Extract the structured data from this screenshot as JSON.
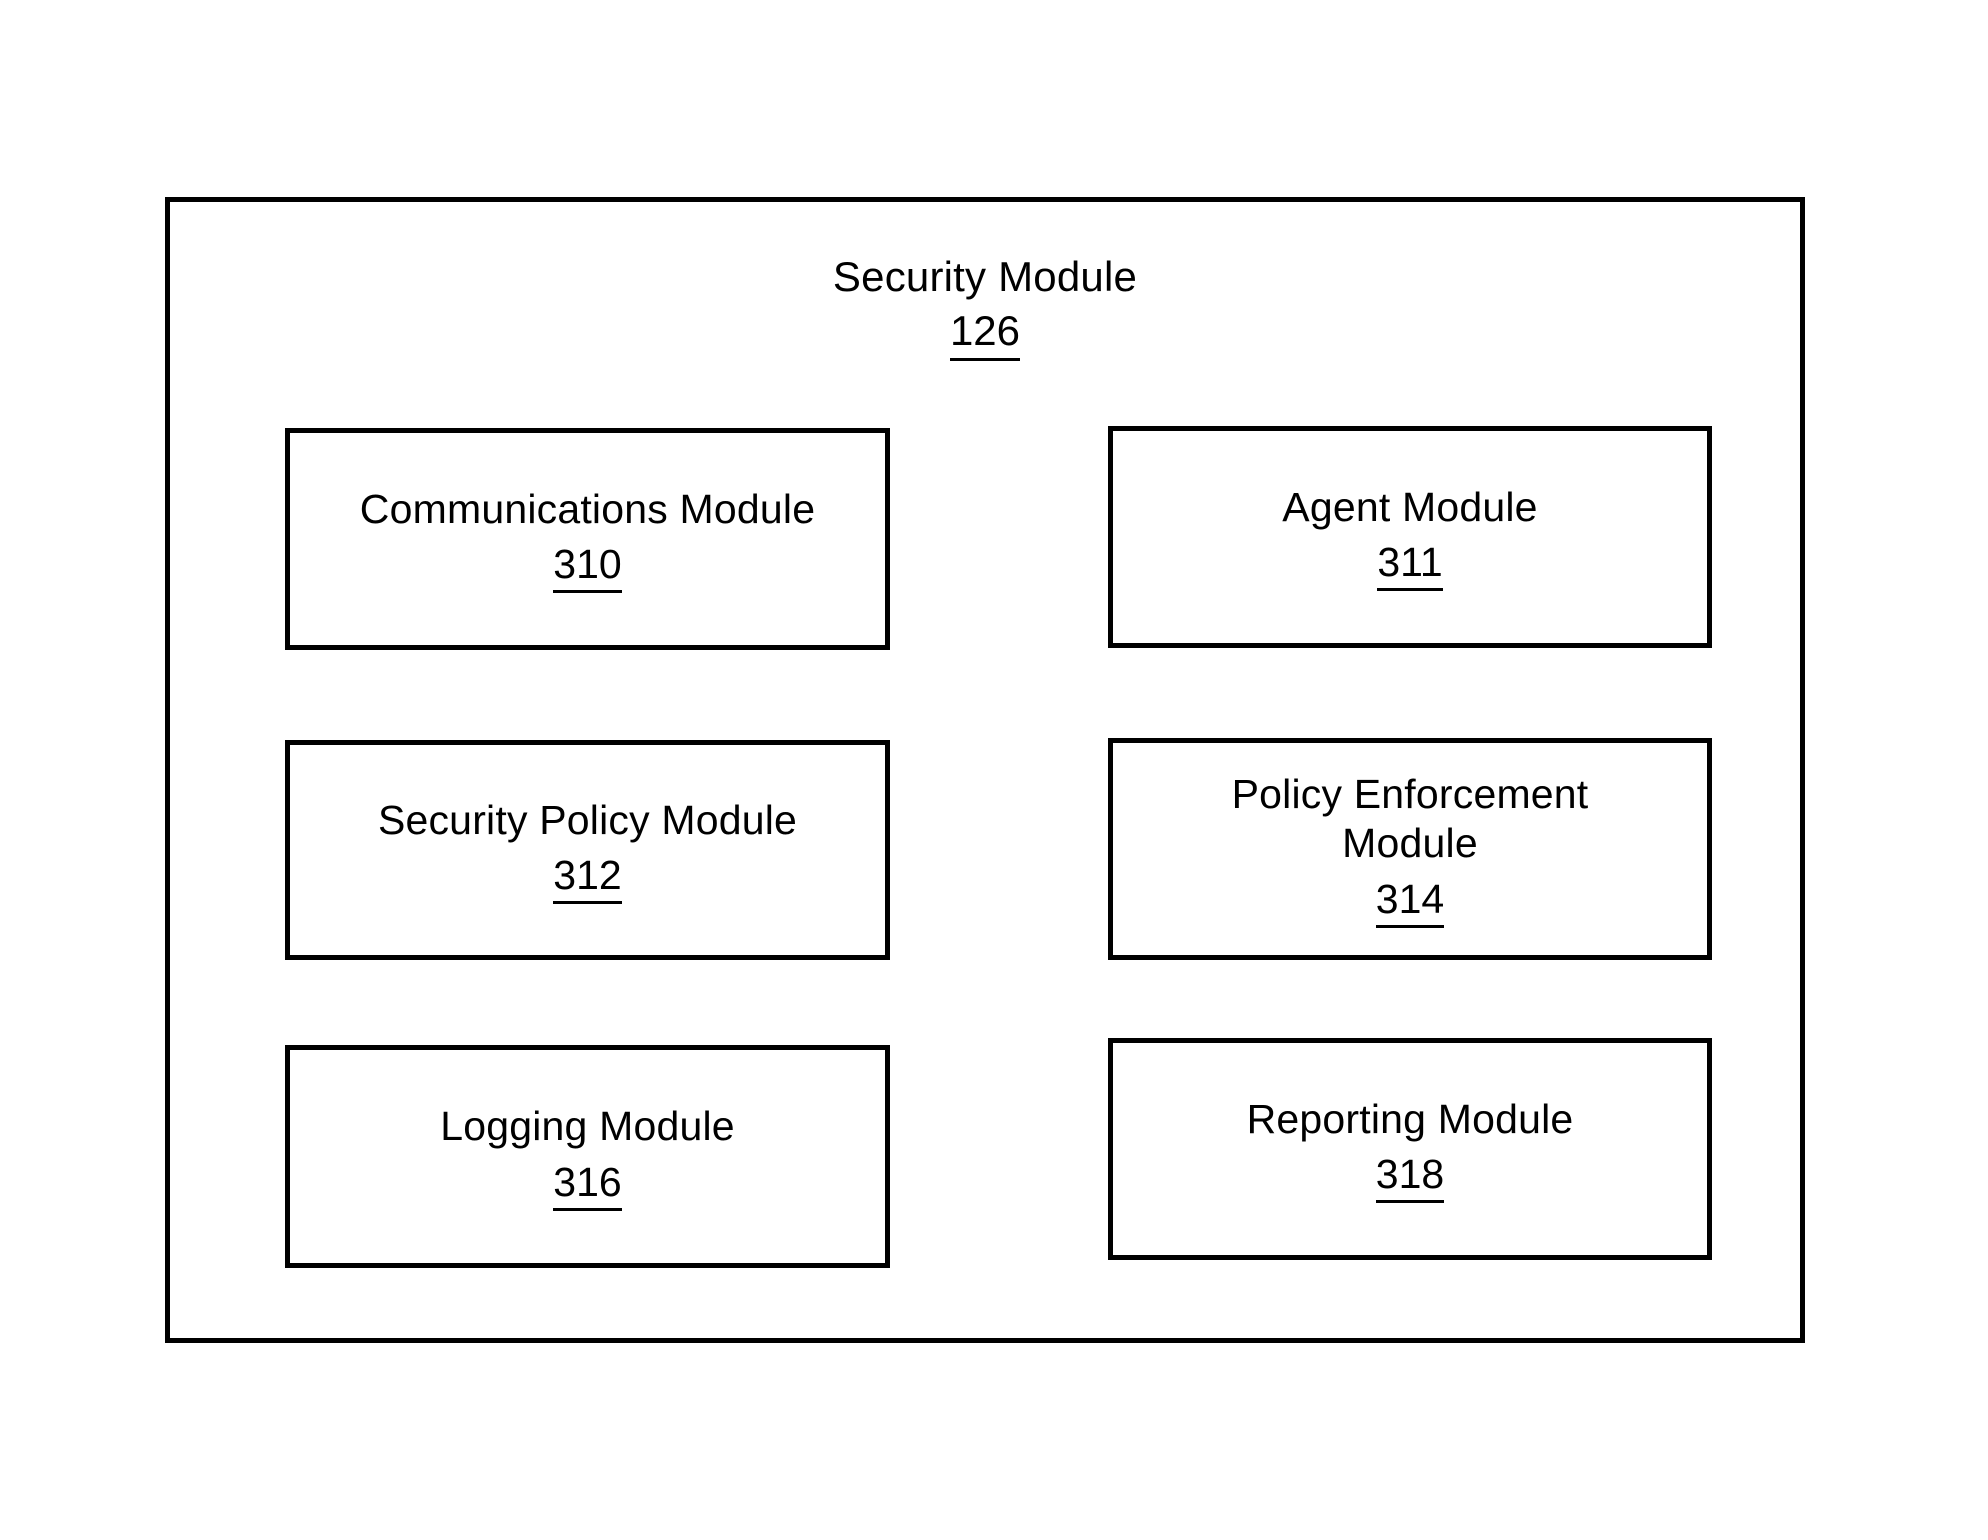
{
  "diagram": {
    "type": "patent-block-diagram",
    "background_color": "#ffffff",
    "line_color": "#000000",
    "container": {
      "title": "Security Module",
      "reference_numeral": "126"
    },
    "modules": [
      {
        "id": "310",
        "label": "Communications Module",
        "reference_numeral": "310",
        "column": "left",
        "row": 1
      },
      {
        "id": "311",
        "label": "Agent Module",
        "reference_numeral": "311",
        "column": "right",
        "row": 1
      },
      {
        "id": "312",
        "label": "Security Policy Module",
        "reference_numeral": "312",
        "column": "left",
        "row": 2
      },
      {
        "id": "314",
        "label": "Policy Enforcement\nModule",
        "reference_numeral": "314",
        "column": "right",
        "row": 2
      },
      {
        "id": "316",
        "label": "Logging Module",
        "reference_numeral": "316",
        "column": "left",
        "row": 3
      },
      {
        "id": "318",
        "label": "Reporting Module",
        "reference_numeral": "318",
        "column": "right",
        "row": 3
      }
    ]
  }
}
